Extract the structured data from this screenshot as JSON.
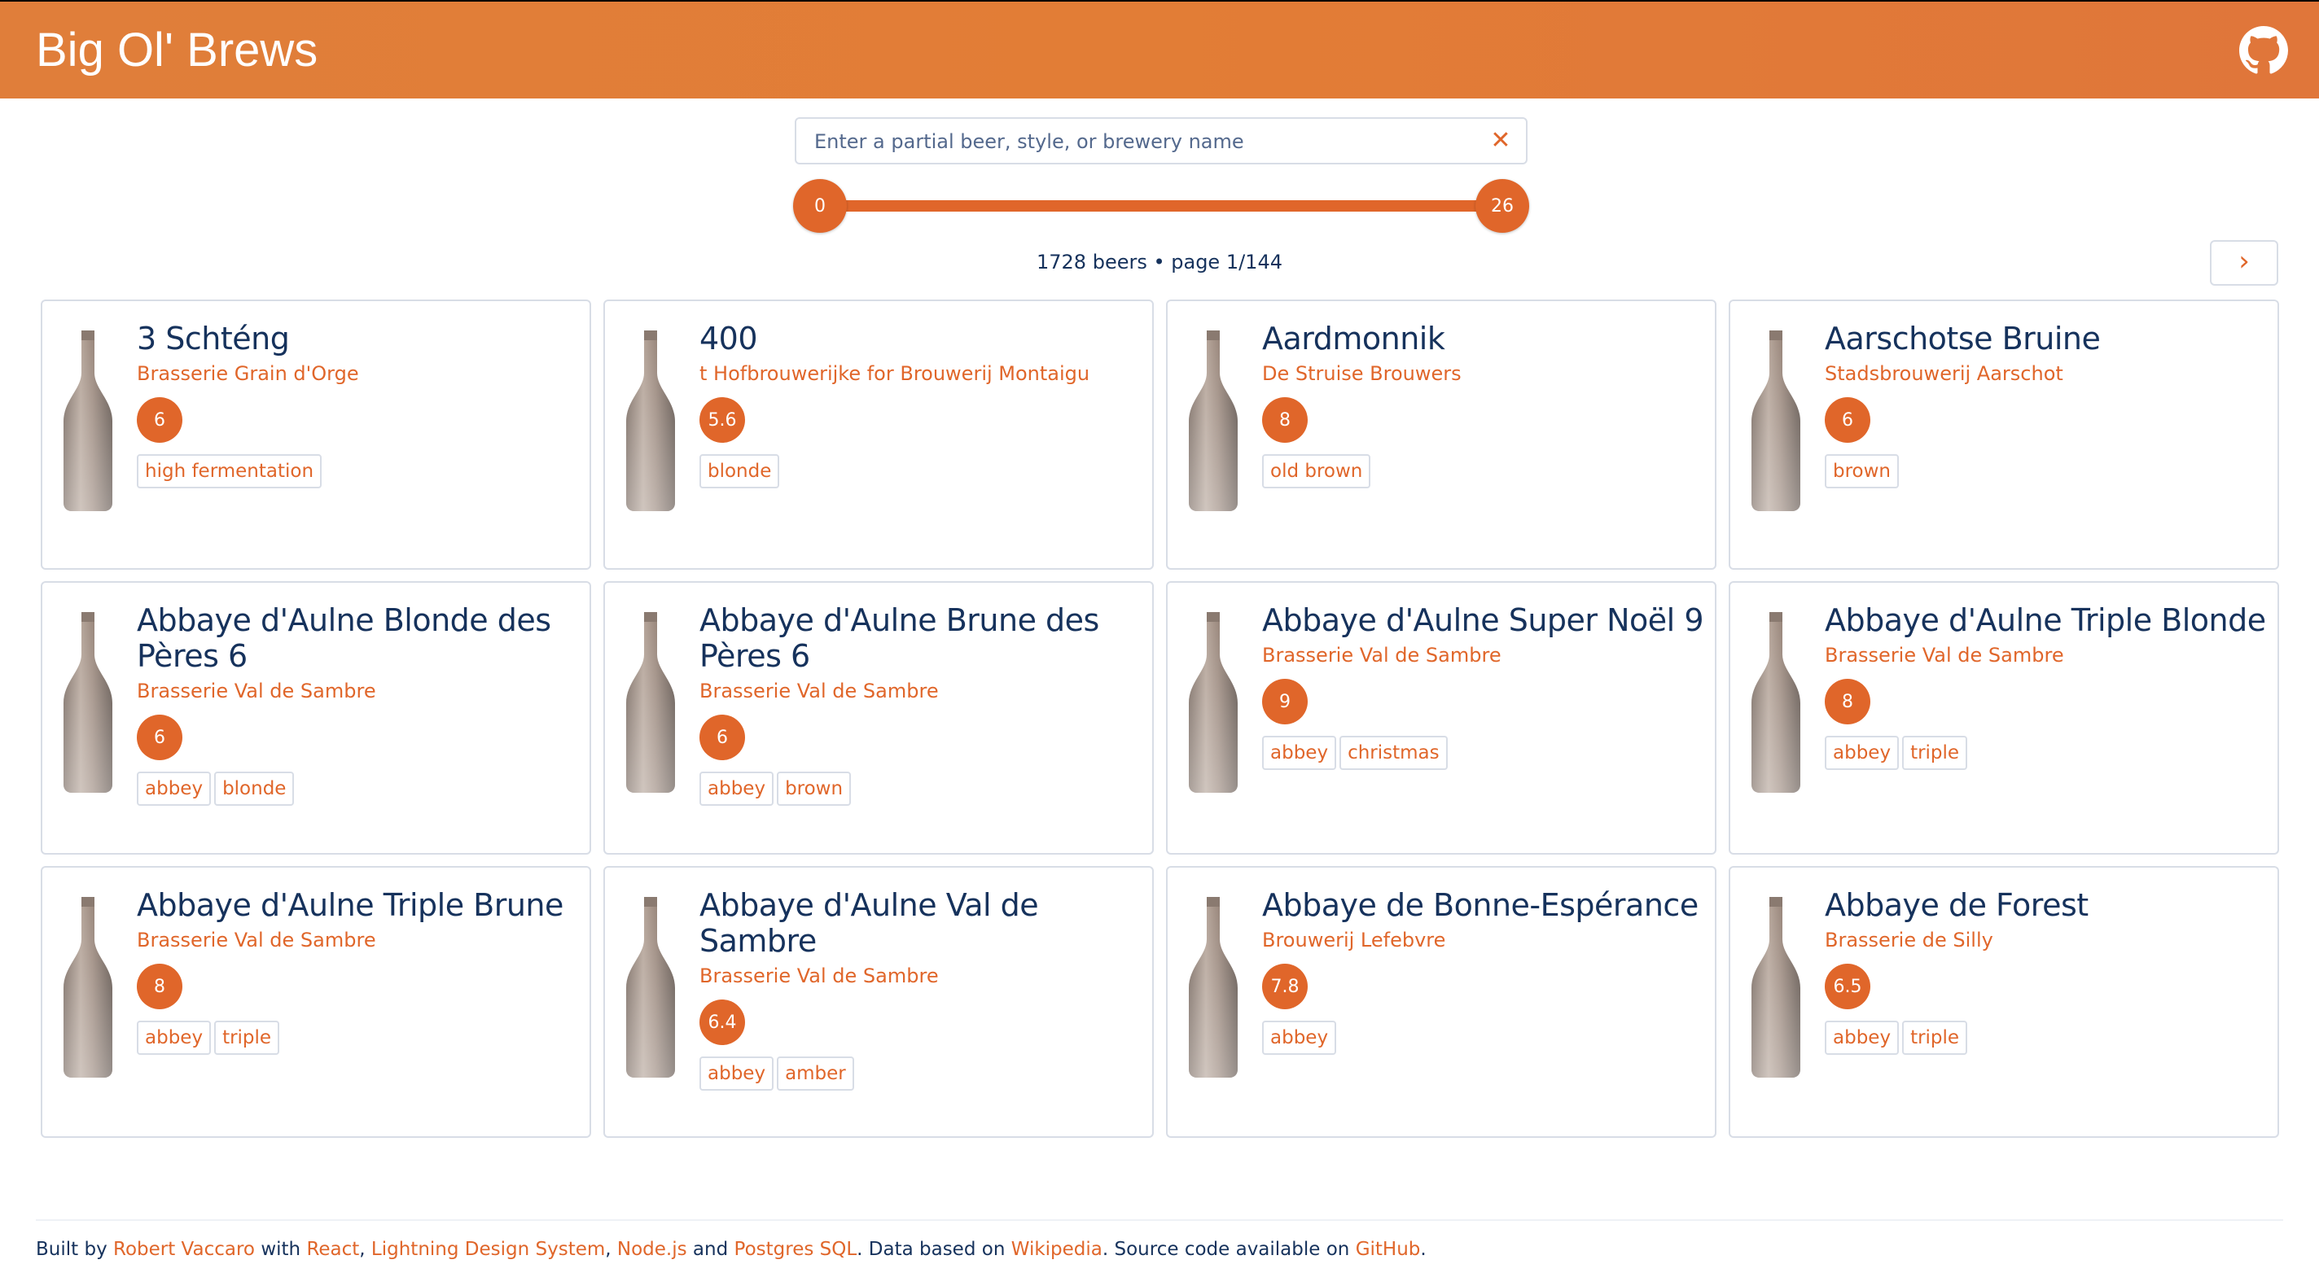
{
  "header": {
    "title": "Big Ol' Brews",
    "github_icon": "github-icon"
  },
  "search": {
    "placeholder": "Enter a partial beer, style, or brewery name",
    "value": ""
  },
  "abv_slider": {
    "min": "0",
    "max": "26"
  },
  "results": {
    "count_label": "1728 beers • page 1/144"
  },
  "beers": [
    {
      "name": "3 Schténg",
      "brewery": "Brasserie Grain d'Orge",
      "abv": "6",
      "tags": [
        "high fermentation"
      ]
    },
    {
      "name": "400",
      "brewery": "t Hofbrouwerijke for Brouwerij Montaigu",
      "abv": "5.6",
      "tags": [
        "blonde"
      ]
    },
    {
      "name": "Aardmonnik",
      "brewery": "De Struise Brouwers",
      "abv": "8",
      "tags": [
        "old brown"
      ]
    },
    {
      "name": "Aarschotse Bruine",
      "brewery": "Stadsbrouwerij Aarschot",
      "abv": "6",
      "tags": [
        "brown"
      ]
    },
    {
      "name": "Abbaye d'Aulne Blonde des Pères 6",
      "brewery": "Brasserie Val de Sambre",
      "abv": "6",
      "tags": [
        "abbey",
        "blonde"
      ]
    },
    {
      "name": "Abbaye d'Aulne Brune des Pères 6",
      "brewery": "Brasserie Val de Sambre",
      "abv": "6",
      "tags": [
        "abbey",
        "brown"
      ]
    },
    {
      "name": "Abbaye d'Aulne Super Noël 9",
      "brewery": "Brasserie Val de Sambre",
      "abv": "9",
      "tags": [
        "abbey",
        "christmas"
      ]
    },
    {
      "name": "Abbaye d'Aulne Triple Blonde",
      "brewery": "Brasserie Val de Sambre",
      "abv": "8",
      "tags": [
        "abbey",
        "triple"
      ]
    },
    {
      "name": "Abbaye d'Aulne Triple Brune",
      "brewery": "Brasserie Val de Sambre",
      "abv": "8",
      "tags": [
        "abbey",
        "triple"
      ]
    },
    {
      "name": "Abbaye d'Aulne Val de Sambre",
      "brewery": "Brasserie Val de Sambre",
      "abv": "6.4",
      "tags": [
        "abbey",
        "amber"
      ]
    },
    {
      "name": "Abbaye de Bonne-Espérance",
      "brewery": "Brouwerij Lefebvre",
      "abv": "7.8",
      "tags": [
        "abbey"
      ]
    },
    {
      "name": "Abbaye de Forest",
      "brewery": "Brasserie de Silly",
      "abv": "6.5",
      "tags": [
        "abbey",
        "triple"
      ]
    }
  ],
  "footer": {
    "t1": "Built by ",
    "author": "Robert Vaccaro",
    "t2": " with ",
    "react": "React",
    "t3": ", ",
    "lds": "Lightning Design System",
    "t4": ", ",
    "node": "Node.js",
    "t5": " and ",
    "postgres": "Postgres SQL",
    "t6": ". Data based on ",
    "wikipedia": "Wikipedia",
    "t7": ". Source code available on ",
    "github": "GitHub",
    "t8": "."
  },
  "colors": {
    "accent": "#e0662a",
    "header": "#e07e3a",
    "text": "#16325c",
    "border": "#d8dde6"
  },
  "icons": {
    "clear": "close-icon",
    "next": "chevron-right-icon",
    "bottle": "beer-bottle-icon"
  }
}
